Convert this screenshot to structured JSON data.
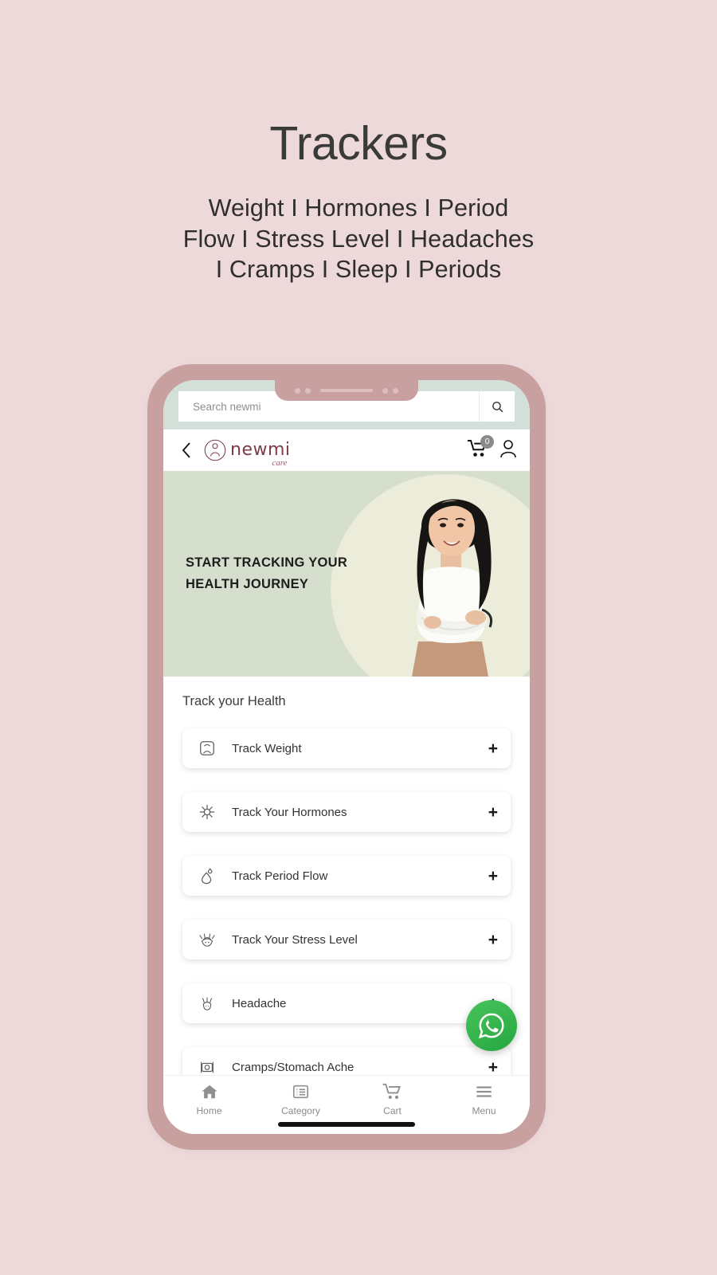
{
  "promo": {
    "title": "Trackers",
    "subtitle_lines": [
      "Weight I Hormones I Period",
      "Flow I Stress Level I Headaches",
      "I Cramps I Sleep I Periods"
    ]
  },
  "colors": {
    "page_background": "#EDD9D9",
    "phone_frame": "#C9A0A0",
    "status_strip": "#D3DFD9",
    "banner_background": "#D6DFCD",
    "banner_circle": "#EBECD9",
    "brand": "#7E3B47",
    "whatsapp_green": "#25A63F"
  },
  "search": {
    "placeholder": "Search newmi",
    "value": "",
    "icon": "search-icon",
    "button_icon": "magnifier-icon"
  },
  "header": {
    "back_icon": "chevron-left-icon",
    "logo_main": "newmi",
    "logo_sub": "care",
    "logo_mark": "woman-in-circle-icon",
    "cart_icon": "shopping-cart-icon",
    "cart_count": "0",
    "account_icon": "user-account-icon"
  },
  "banner": {
    "heading_line1": "START TRACKING YOUR",
    "heading_line2": "HEALTH JOURNEY",
    "image": "smiling-woman-photo"
  },
  "main": {
    "section_title": "Track your Health",
    "add_symbol": "+",
    "items": [
      {
        "label": "Track Weight",
        "icon": "weight-scale-icon"
      },
      {
        "label": "Track Your Hormones",
        "icon": "flower-hormone-icon"
      },
      {
        "label": "Track Period Flow",
        "icon": "blood-drop-icon"
      },
      {
        "label": "Track Your Stress Level",
        "icon": "stressed-face-icon"
      },
      {
        "label": "Headache",
        "icon": "headache-face-icon"
      },
      {
        "label": "Cramps/Stomach Ache",
        "icon": "stomach-cramps-icon"
      }
    ]
  },
  "fab": {
    "icon": "whatsapp-icon",
    "label": "WhatsApp"
  },
  "bottom_nav": {
    "items": [
      {
        "label": "Home",
        "icon": "home-icon"
      },
      {
        "label": "Category",
        "icon": "list-category-icon"
      },
      {
        "label": "Cart",
        "icon": "cart-icon"
      },
      {
        "label": "Menu",
        "icon": "hamburger-menu-icon"
      }
    ]
  }
}
